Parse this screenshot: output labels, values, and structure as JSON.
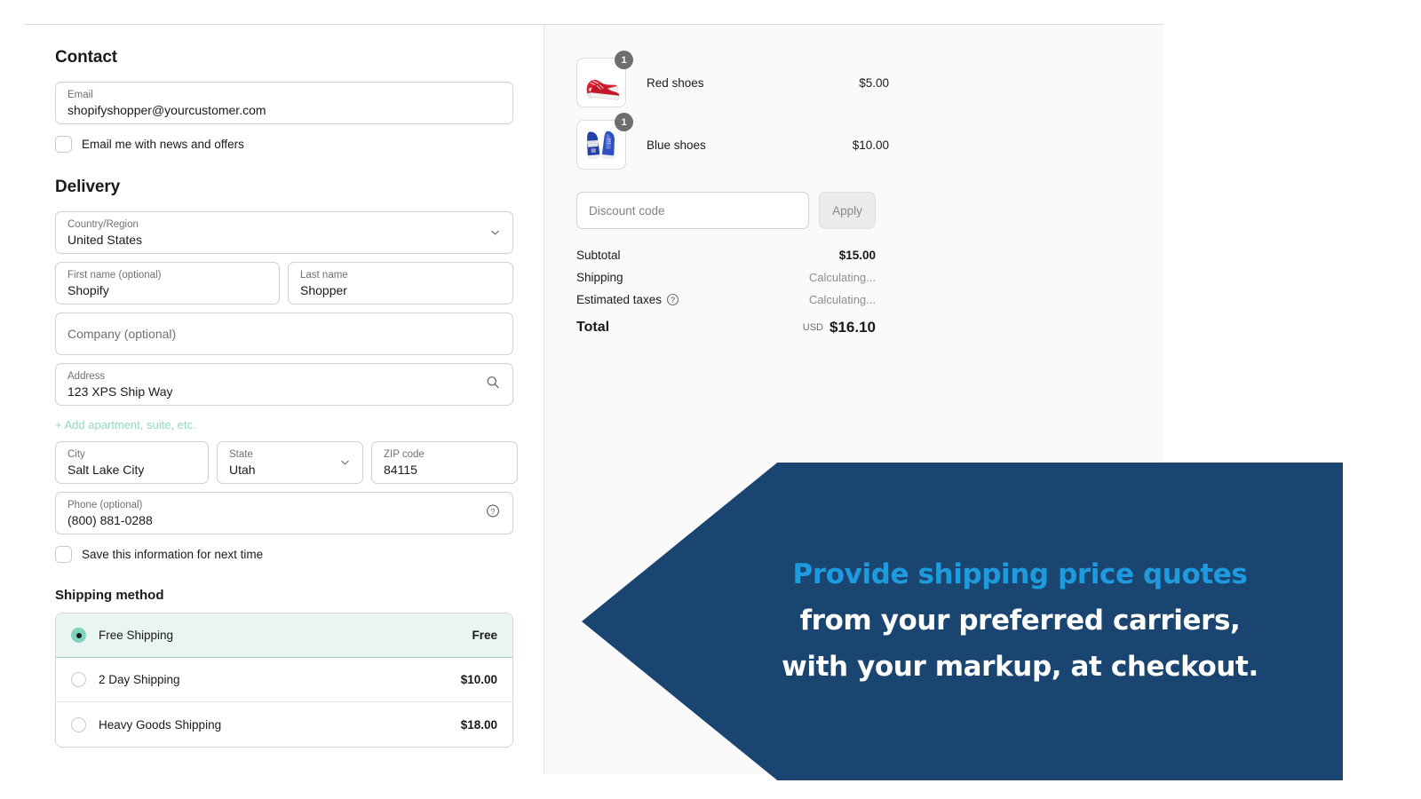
{
  "contact": {
    "heading": "Contact",
    "email": {
      "label": "Email",
      "value": "shopifyshopper@yourcustomer.com"
    },
    "newsletter_label": "Email me with news and offers"
  },
  "delivery": {
    "heading": "Delivery",
    "country": {
      "label": "Country/Region",
      "value": "United States"
    },
    "first_name": {
      "label": "First name (optional)",
      "value": "Shopify"
    },
    "last_name": {
      "label": "Last name",
      "value": "Shopper"
    },
    "company": {
      "placeholder": "Company (optional)"
    },
    "address": {
      "label": "Address",
      "value": "123 XPS Ship Way"
    },
    "add_apartment_link": "+ Add apartment, suite, etc.",
    "city": {
      "label": "City",
      "value": "Salt Lake City"
    },
    "state": {
      "label": "State",
      "value": "Utah"
    },
    "zip": {
      "label": "ZIP code",
      "value": "84115"
    },
    "phone": {
      "label": "Phone (optional)",
      "value": "(800) 881-0288"
    },
    "save_info_label": "Save this information for next time"
  },
  "shipping": {
    "heading": "Shipping method",
    "options": [
      {
        "name": "Free Shipping",
        "price": "Free",
        "selected": true
      },
      {
        "name": "2 Day Shipping",
        "price": "$10.00",
        "selected": false
      },
      {
        "name": "Heavy Goods Shipping",
        "price": "$18.00",
        "selected": false
      }
    ]
  },
  "summary": {
    "items": [
      {
        "name": "Red shoes",
        "price": "$5.00",
        "qty": "1",
        "image": "red-sneakers"
      },
      {
        "name": "Blue shoes",
        "price": "$10.00",
        "qty": "1",
        "image": "blue-sneakers"
      }
    ],
    "discount": {
      "placeholder": "Discount code",
      "apply_label": "Apply"
    },
    "subtotal": {
      "label": "Subtotal",
      "value": "$15.00"
    },
    "shipping": {
      "label": "Shipping",
      "value": "Calculating..."
    },
    "taxes": {
      "label": "Estimated taxes",
      "value": "Calculating...",
      "info_icon": "question-circle-icon"
    },
    "total": {
      "label": "Total",
      "currency": "USD",
      "value": "$16.10"
    }
  },
  "banner": {
    "line1": "Provide shipping price quotes",
    "line2": "from your preferred carriers,",
    "line3": "with your markup, at checkout.",
    "bg_color": "#194570",
    "accent_color": "#1e9bdf"
  },
  "theme": {
    "accent_teal": "#7fd3bd",
    "link_mint": "#95d5c6",
    "panel_bg": "#fafafa"
  }
}
